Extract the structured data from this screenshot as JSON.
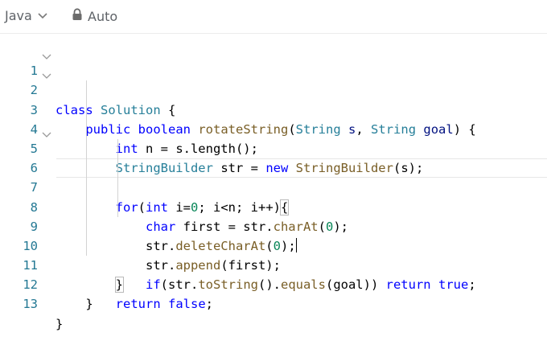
{
  "toolbar": {
    "language": "Java",
    "mode": "Auto",
    "icons": [
      "chevron-down-icon",
      "lock-icon"
    ]
  },
  "editor": {
    "line_numbers": [
      "1",
      "2",
      "3",
      "4",
      "5",
      "6",
      "7",
      "8",
      "9",
      "10",
      "11",
      "12",
      "13"
    ],
    "lines": [
      "class Solution {",
      "    public boolean rotateString(String s, String goal) {",
      "        int n = s.length();",
      "        StringBuilder str = new StringBuilder(s);",
      "        for(int i=0; i<n; i++){",
      "            char first = str.charAt(0);",
      "            str.deleteCharAt(0);",
      "            str.append(first);",
      "            if(str.toString().equals(goal)) return true;",
      "        }",
      "        return false;",
      "    }",
      "}"
    ],
    "current_line": 7,
    "colors": {
      "keyword": "#0000ff",
      "type": "#267f99",
      "function": "#795e26",
      "number": "#098658",
      "line_number": "#237893"
    }
  }
}
